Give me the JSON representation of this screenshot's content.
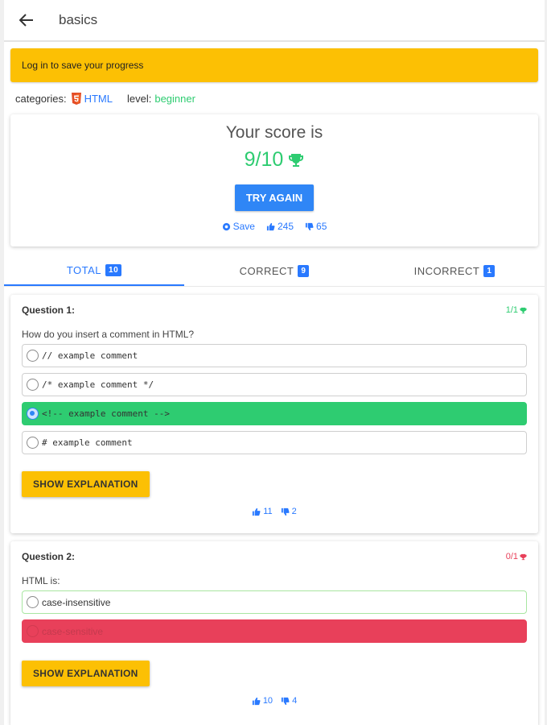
{
  "header": {
    "title": "basics"
  },
  "banner": {
    "text": "Log in to save your progress"
  },
  "meta": {
    "categories_label": "categories:",
    "category": "HTML",
    "level_label": "level:",
    "level": "beginner"
  },
  "score": {
    "title": "Your score is",
    "value": "9/10",
    "try_again": "TRY AGAIN",
    "save": "Save",
    "likes": "245",
    "dislikes": "65"
  },
  "tabs": [
    {
      "label": "TOTAL",
      "count": "10",
      "active": true
    },
    {
      "label": "CORRECT",
      "count": "9",
      "active": false
    },
    {
      "label": "INCORRECT",
      "count": "1",
      "active": false
    }
  ],
  "questions": [
    {
      "label": "Question 1:",
      "score": "1/1",
      "text": "How do you insert a comment in HTML?",
      "options": [
        {
          "text": "// example comment",
          "state": "none"
        },
        {
          "text": "/* example comment */",
          "state": "none"
        },
        {
          "text": "<!-- example comment -->",
          "state": "correct"
        },
        {
          "text": "# example comment",
          "state": "none"
        }
      ],
      "explain": "SHOW EXPLANATION",
      "likes": "11",
      "dislikes": "2"
    },
    {
      "label": "Question 2:",
      "score": "0/1",
      "text": "HTML is:",
      "options": [
        {
          "text": "case-insensitive",
          "state": "answer"
        },
        {
          "text": "case-sensitive",
          "state": "wrong"
        }
      ],
      "explain": "SHOW EXPLANATION",
      "likes": "10",
      "dislikes": "4"
    }
  ],
  "colors": {
    "accent": "#2979ff",
    "banner": "#fcc004",
    "success": "#2ecc71",
    "danger": "#e8405a",
    "button": "#2f86f6"
  },
  "icons": [
    "back-arrow-icon",
    "html5-icon",
    "trophy-icon",
    "gear-icon",
    "thumbs-up-icon",
    "thumbs-down-icon"
  ]
}
